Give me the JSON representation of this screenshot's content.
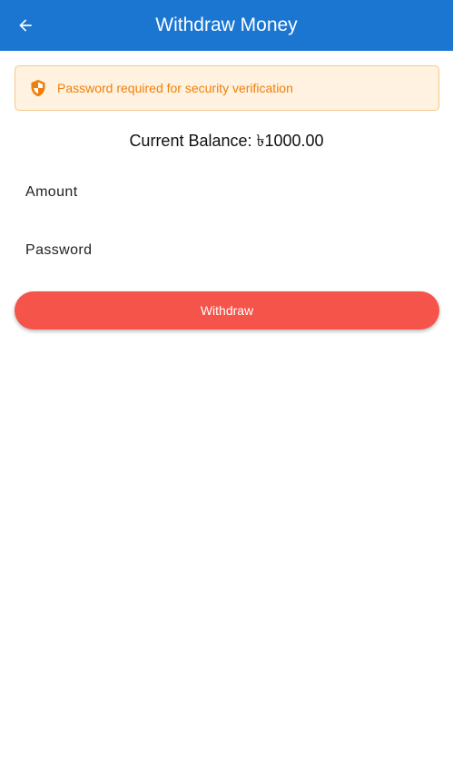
{
  "app_bar": {
    "title": "Withdraw Money",
    "back_icon": "arrow-left-icon",
    "background_color": "#1b76d2"
  },
  "notice": {
    "icon": "shield-icon",
    "text": "Password required for security verification",
    "text_color": "#ef7f0c",
    "background_color": "#fff2e0"
  },
  "balance": {
    "text": "Current Balance: ৳1000.00"
  },
  "form": {
    "amount_label": "Amount",
    "amount_value": "",
    "password_label": "Password",
    "password_value": ""
  },
  "withdraw_button": {
    "label": "Withdraw",
    "color": "#f4544a"
  }
}
